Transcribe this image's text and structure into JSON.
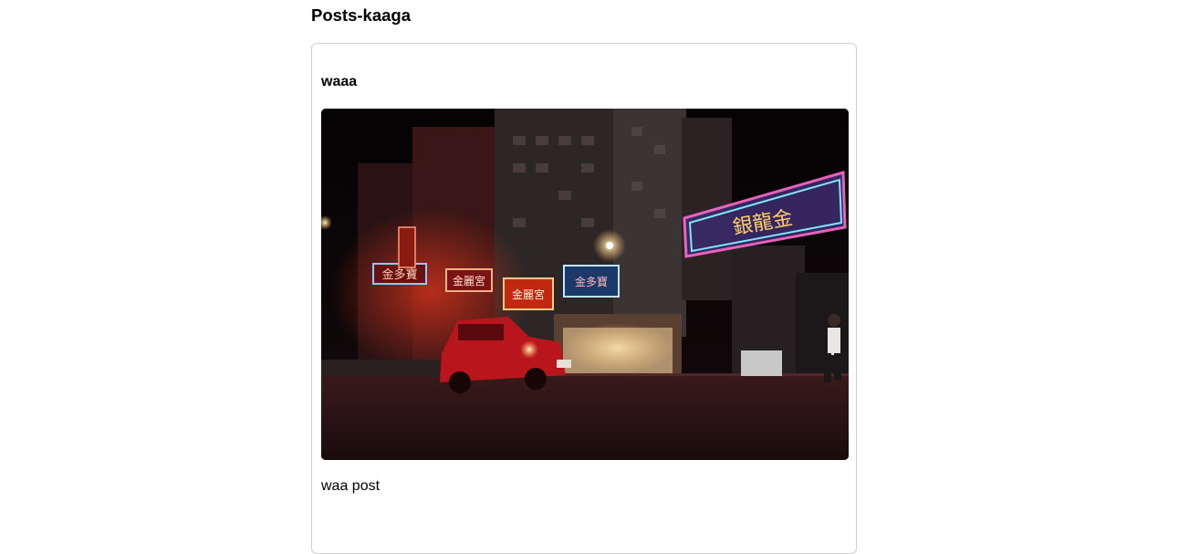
{
  "page": {
    "title": "Posts-kaaga"
  },
  "post": {
    "title": "waaa",
    "body": "waa post",
    "image": {
      "icon": "night-street-neon-photo",
      "signs": {
        "sign_1": "金多寶",
        "sign_2": "金麗宮",
        "sign_3": "金麗宮",
        "sign_4": "金多寶",
        "sign_big": "銀龍金"
      }
    }
  }
}
